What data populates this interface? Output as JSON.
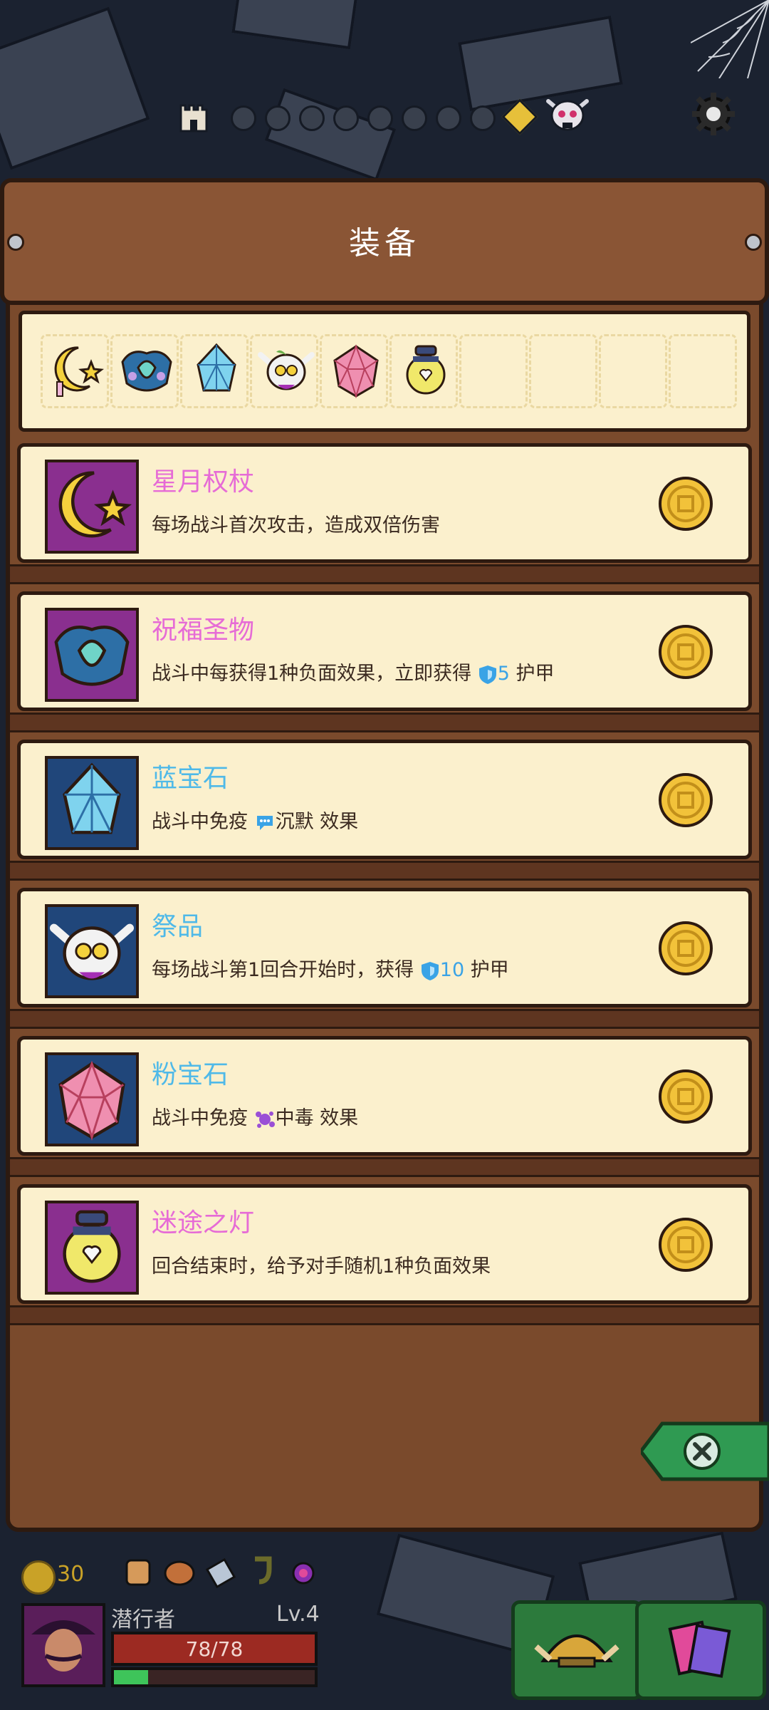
{
  "window": {
    "title": "装备"
  },
  "progress": {
    "total_nodes": 8,
    "icons": [
      "castle-icon",
      "diamond-node-icon",
      "boss-skull-icon"
    ]
  },
  "inventory": {
    "slot_count": 10,
    "items": [
      "crescent-scepter-icon",
      "blessed-relic-icon",
      "sapphire-icon",
      "offering-skull-icon",
      "pink-gem-icon",
      "lost-lantern-icon"
    ]
  },
  "equipment": [
    {
      "name": "星月权杖",
      "name_color": "#e66bd6",
      "desc": "每场战斗首次攻击，造成双倍伤害",
      "icon": "crescent-scepter-icon",
      "frame_color": "#8a2f8f"
    },
    {
      "name": "祝福圣物",
      "name_color": "#e66bd6",
      "desc_pre": "战斗中每获得1种负面效果，立即获得 ",
      "desc_num": "5",
      "desc_post": " 护甲",
      "icon": "blessed-relic-icon",
      "frame_color": "#8a2f8f"
    },
    {
      "name": "蓝宝石",
      "name_color": "#4fb9e8",
      "desc_pre": "战斗中免疫 ",
      "desc_effect": "沉默",
      "desc_post": " 效果",
      "icon": "sapphire-icon",
      "frame_color": "#20467a"
    },
    {
      "name": "祭品",
      "name_color": "#4fb9e8",
      "desc_pre": "每场战斗第1回合开始时，获得 ",
      "desc_num": "10",
      "desc_post": " 护甲",
      "icon": "offering-skull-icon",
      "frame_color": "#20467a"
    },
    {
      "name": "粉宝石",
      "name_color": "#4fb9e8",
      "desc_pre": "战斗中免疫 ",
      "desc_effect": "中毒",
      "desc_post": " 效果",
      "icon": "pink-gem-icon",
      "frame_color": "#20467a"
    },
    {
      "name": "迷途之灯",
      "name_color": "#e66bd6",
      "desc": "回合结束时，给予对手随机1种负面效果",
      "icon": "lost-lantern-icon",
      "frame_color": "#8a2f8f"
    }
  ],
  "hud": {
    "gold": "30",
    "character_name": "潜行者",
    "level": "Lv.4",
    "hp": "78/78",
    "xp_fraction": 0.17
  },
  "colors": {
    "panel": "#7a4a2c",
    "parchment": "#fbf0cd",
    "epic": "#e66bd6",
    "rare": "#4fb9e8",
    "close_tab": "#2f9a52"
  }
}
